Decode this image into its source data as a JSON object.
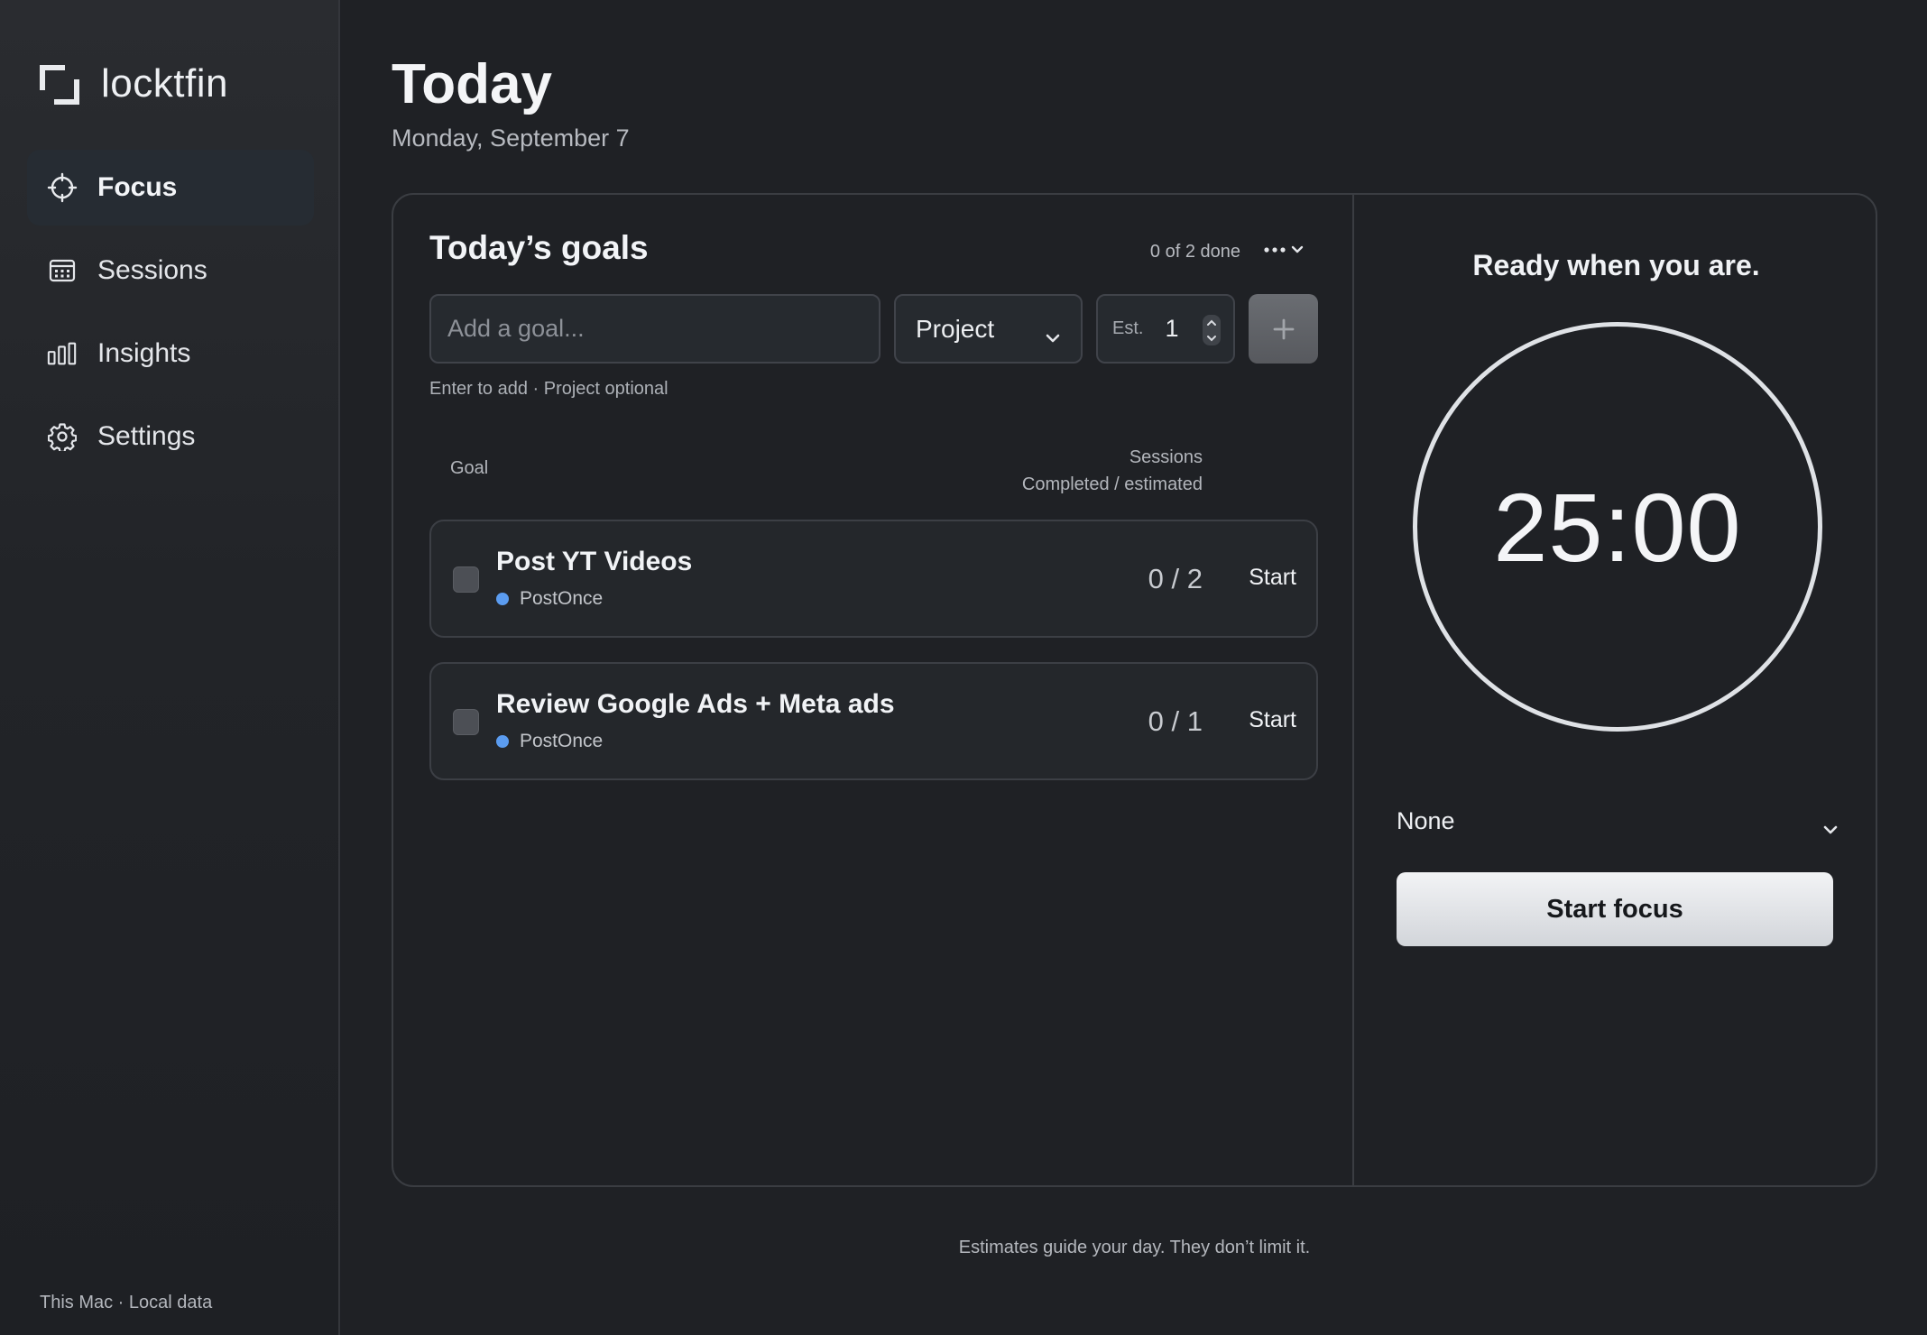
{
  "app": {
    "name": "locktfin"
  },
  "sidebar": {
    "items": [
      {
        "label": "Focus",
        "icon": "crosshair-icon",
        "active": true
      },
      {
        "label": "Sessions",
        "icon": "calendar-icon",
        "active": false
      },
      {
        "label": "Insights",
        "icon": "bar-chart-icon",
        "active": false
      },
      {
        "label": "Settings",
        "icon": "gear-icon",
        "active": false
      }
    ],
    "footer": "This Mac · Local data"
  },
  "header": {
    "title": "Today",
    "date": "Monday, September 7"
  },
  "goals": {
    "title": "Today’s goals",
    "done_count": "0 of 2 done",
    "input_placeholder": "Add a goal...",
    "project_label": "Project",
    "est_label": "Est.",
    "est_value": "1",
    "hint": "Enter to add · Project optional",
    "col_goal": "Goal",
    "col_sessions_1": "Sessions",
    "col_sessions_2": "Completed / estimated",
    "rows": [
      {
        "name": "Post YT Videos",
        "project": "PostOnce",
        "count": "0 / 2",
        "action": "Start"
      },
      {
        "name": "Review Google Ads + Meta ads",
        "project": "PostOnce",
        "count": "0 / 1",
        "action": "Start"
      }
    ]
  },
  "timer": {
    "ready_text": "Ready when you are.",
    "time": "25:00",
    "project_value": "None",
    "start_label": "Start focus"
  },
  "footer_note": "Estimates guide your day. They don’t limit it.",
  "colors": {
    "project_dot": "#5b9cf0",
    "accent": "#dfe2e6",
    "background": "#1f2125"
  }
}
